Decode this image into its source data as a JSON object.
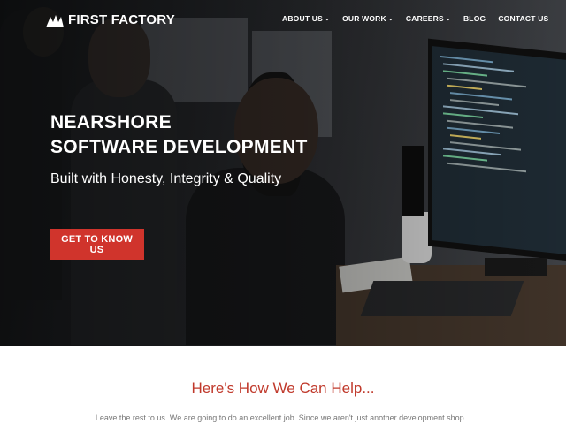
{
  "brand": {
    "name": "FIRST FACTORY",
    "icon": "first-factory-logo-icon"
  },
  "nav": {
    "items": [
      {
        "label": "ABOUT US",
        "has_dropdown": true
      },
      {
        "label": "OUR WORK",
        "has_dropdown": true
      },
      {
        "label": "CAREERS",
        "has_dropdown": true
      },
      {
        "label": "BLOG",
        "has_dropdown": false
      },
      {
        "label": "CONTACT US",
        "has_dropdown": false
      }
    ],
    "dropdown_icon": "chevron-down-icon"
  },
  "hero": {
    "title_line1": "NEARSHORE",
    "title_line2": "SOFTWARE DEVELOPMENT",
    "subtitle": "Built with Honesty, Integrity & Quality",
    "cta_label": "GET TO KNOW US",
    "cta_color": "#d0342c"
  },
  "help": {
    "heading": "Here's How We Can Help...",
    "heading_color": "#c0392b",
    "intro": "Leave the rest to us. We are going to do an excellent job. Since we aren't just another development shop..."
  }
}
